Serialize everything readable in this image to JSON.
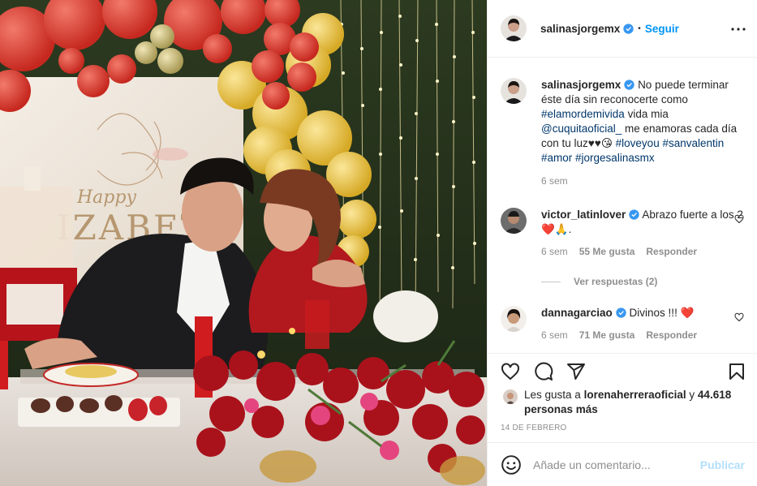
{
  "post": {
    "author": "salinasjorgemx",
    "follow_label": "Seguir",
    "separator": "•",
    "caption": {
      "text_1": "No puede terminar éste día sin reconocerte como",
      "hashtag_1": "#elamordemivida",
      "text_2": "vida mia",
      "mention": "@cuquitaoficial_",
      "text_3": "me enamoras cada día con tu luz♥♥😘",
      "hashtag_2": "#loveyou",
      "hashtag_3": "#sanvalentin",
      "hashtag_4": "#amor",
      "hashtag_5": "#jorgesalinasmx",
      "time": "6 sem"
    },
    "comments": [
      {
        "user": "victor_latinlover",
        "text": "Abrazo fuerte a los 2 ❤️🙏.",
        "time": "6 sem",
        "likes": "55 Me gusta",
        "reply_label": "Responder",
        "view_replies": "Ver respuestas (2)"
      },
      {
        "user": "dannagarciao",
        "text": "Divinos !!! ❤️",
        "time": "6 sem",
        "likes": "71 Me gusta",
        "reply_label": "Responder"
      }
    ],
    "likes_line": {
      "prefix": "Les gusta a",
      "user": "lorenaherreraoficial",
      "middle": "y",
      "others": "44.618 personas más"
    },
    "date": "14 DE FEBRERO",
    "composer": {
      "placeholder": "Añade un comentario...",
      "publish_label": "Publicar"
    }
  },
  "icons": {
    "verified": "verified-badge-icon",
    "more": "more-options-icon",
    "like": "heart-icon",
    "comment": "comment-icon",
    "share": "share-icon",
    "save": "bookmark-icon",
    "emoji": "emoji-icon"
  },
  "colors": {
    "accent": "#0095f6",
    "link": "#00376b",
    "muted": "#8e8e8e",
    "publish_disabled": "#b2dffc",
    "verified": "#3897f0"
  }
}
